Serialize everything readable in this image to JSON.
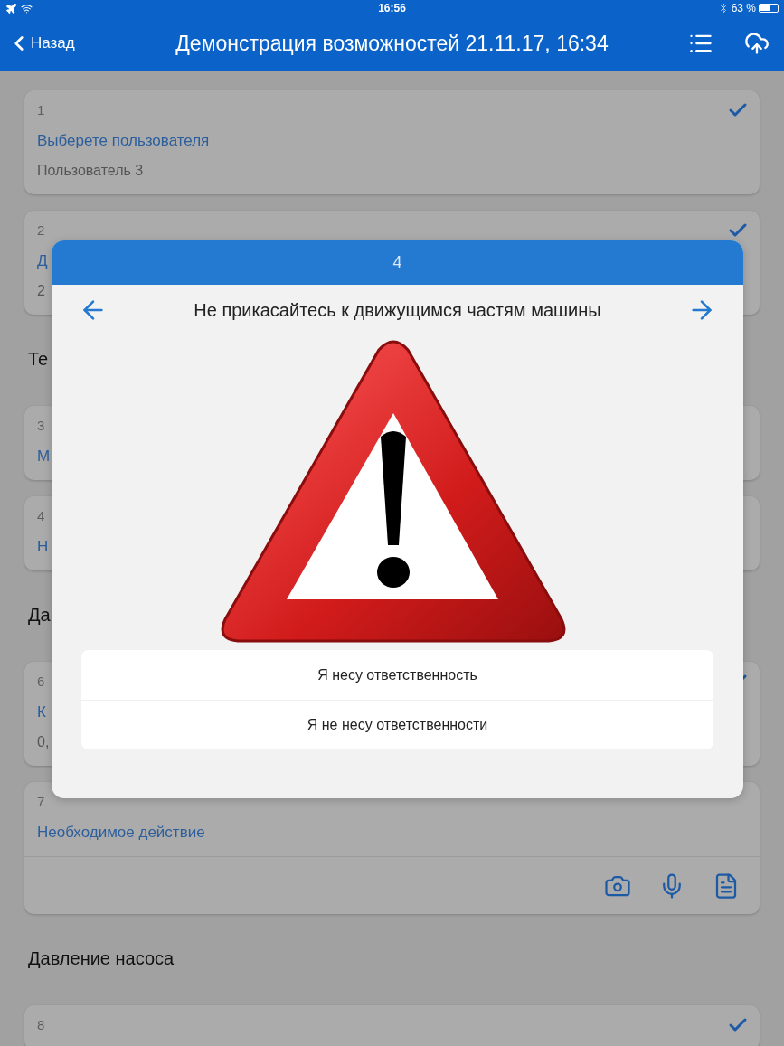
{
  "status_bar": {
    "time": "16:56",
    "battery": "63 %"
  },
  "nav": {
    "back": "Назад",
    "title": "Демонстрация возможностей 21.11.17, 16:34"
  },
  "list": [
    {
      "kind": "card",
      "number": "1",
      "label": "Выберете пользователя",
      "value": "Пользователь 3",
      "done": true
    },
    {
      "kind": "card",
      "number": "2",
      "label": "Д",
      "value": "2",
      "done": true
    },
    {
      "kind": "section",
      "title": "Те"
    },
    {
      "kind": "card",
      "number": "3",
      "label": "М",
      "done": false
    },
    {
      "kind": "card",
      "number": "4",
      "label": "Н",
      "done": false
    },
    {
      "kind": "section",
      "title": "Да"
    },
    {
      "kind": "card",
      "number": "6",
      "label": "К",
      "value": "0,",
      "done": true
    },
    {
      "kind": "action_card",
      "number": "7",
      "label": "Необходимое действие",
      "done": false
    },
    {
      "kind": "section",
      "title": "Давление насоса"
    },
    {
      "kind": "card",
      "number": "8",
      "done": true
    }
  ],
  "dialog": {
    "header": "4",
    "title": "Не прикасайтесь к движущимся частям машины",
    "options": [
      "Я несу ответственность",
      "Я не несу ответственности"
    ]
  }
}
